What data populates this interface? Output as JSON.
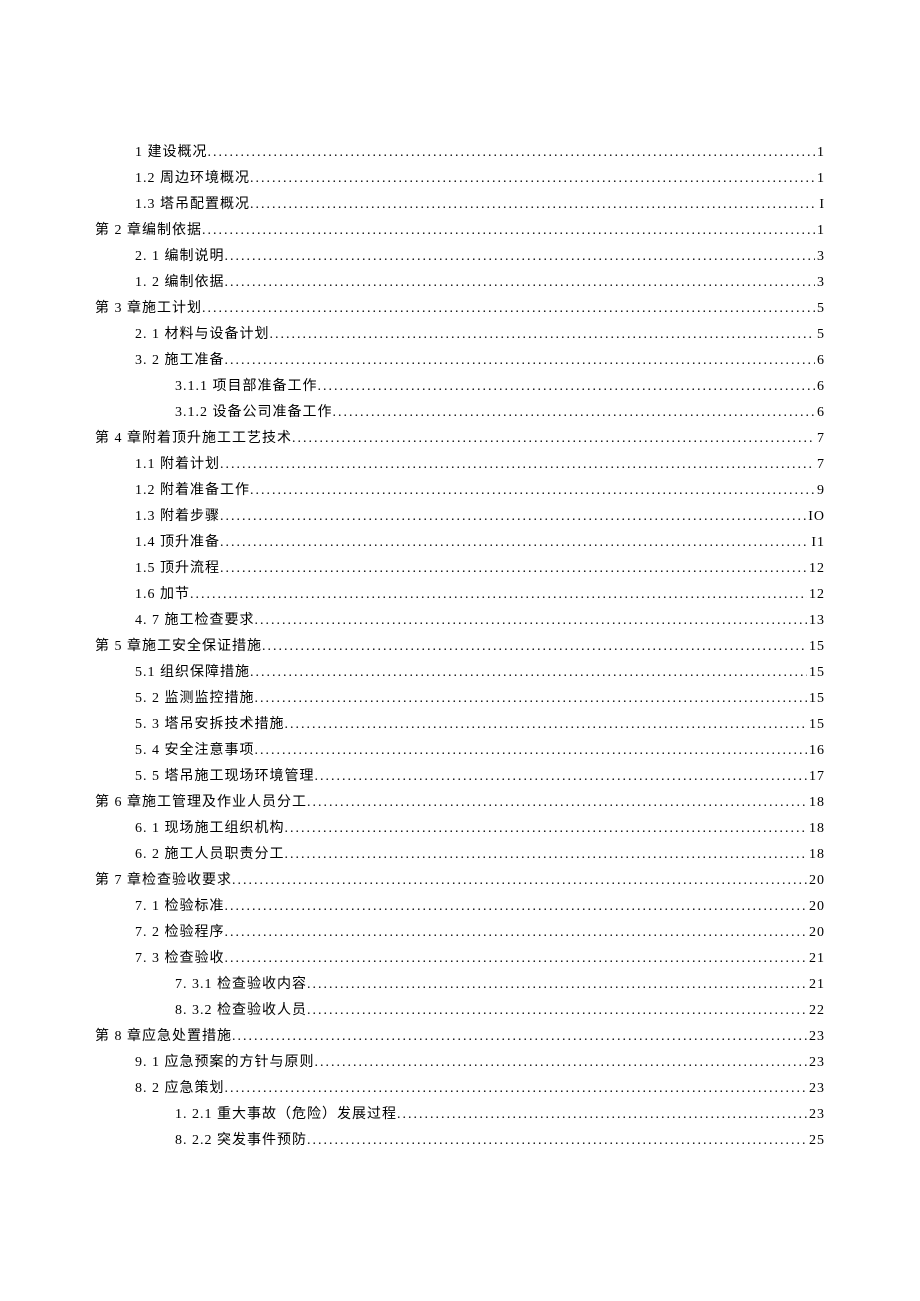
{
  "toc": [
    {
      "indent": 1,
      "label": "1 建设概况",
      "page": "1"
    },
    {
      "indent": 1,
      "label": "1.2 周边环境概况",
      "page": "1"
    },
    {
      "indent": 1,
      "label": "1.3 塔吊配置概况",
      "page": "I"
    },
    {
      "indent": 0,
      "label": "第 2 章编制依据 ",
      "page": "1"
    },
    {
      "indent": 1,
      "label": "2.  1 编制说明 ",
      "page": "3"
    },
    {
      "indent": 1,
      "label": "1.  2 编制依据 ",
      "page": "3"
    },
    {
      "indent": 0,
      "label": "第 3 章施工计划 ",
      "page": "5"
    },
    {
      "indent": 1,
      "label": "2.  1 材料与设备计划 ",
      "page": "5"
    },
    {
      "indent": 1,
      "label": "3.  2 施工准备 ",
      "page": "6"
    },
    {
      "indent": 2,
      "label": "3.1.1 项目部准备工作 ",
      "page": "6"
    },
    {
      "indent": 2,
      "label": "3.1.2 设备公司准备工作 ",
      "page": "6"
    },
    {
      "indent": 0,
      "label": "第 4 章附着顶升施工工艺技术 ",
      "page": "7"
    },
    {
      "indent": 1,
      "label": "1.1  附着计划 ",
      "page": "7"
    },
    {
      "indent": 1,
      "label": "1.2  附着准备工作",
      "page": "9"
    },
    {
      "indent": 1,
      "label": "1.3  附着步骤",
      "page": "IO"
    },
    {
      "indent": 1,
      "label": "1.4  顶升准备",
      "page": "I1"
    },
    {
      "indent": 1,
      "label": "1.5  顶升流程",
      "page": "12"
    },
    {
      "indent": 1,
      "label": "1.6  加节",
      "page": "12"
    },
    {
      "indent": 1,
      "label": "4.  7 施工检查要求 ",
      "page": "13"
    },
    {
      "indent": 0,
      "label": "第 5 章施工安全保证措施 ",
      "page": "15"
    },
    {
      "indent": 1,
      "label": "5.1 组织保障措施",
      "page": "15"
    },
    {
      "indent": 1,
      "label": "5.  2 监测监控措施 ",
      "page": "15"
    },
    {
      "indent": 1,
      "label": "5.  3 塔吊安拆技术措施 ",
      "page": "15"
    },
    {
      "indent": 1,
      "label": "5.  4 安全注意事项 ",
      "page": "16"
    },
    {
      "indent": 1,
      "label": "5.  5 塔吊施工现场环境管理 ",
      "page": "17"
    },
    {
      "indent": 0,
      "label": "第 6 章施工管理及作业人员分工 ",
      "page": "18"
    },
    {
      "indent": 1,
      "label": "6.  1 现场施工组织机构 ",
      "page": "18"
    },
    {
      "indent": 1,
      "label": "6.  2 施工人员职责分工 ",
      "page": "18"
    },
    {
      "indent": 0,
      "label": "第 7 章检查验收要求 ",
      "page": "20"
    },
    {
      "indent": 1,
      "label": "7.  1 检验标准 ",
      "page": "20"
    },
    {
      "indent": 1,
      "label": "7.  2 检验程序 ",
      "page": "20"
    },
    {
      "indent": 1,
      "label": "7.  3 检查验收 ",
      "page": "21"
    },
    {
      "indent": 2,
      "label": "7.  3.1 检查验收内容 ",
      "page": "21"
    },
    {
      "indent": 2,
      "label": "8.  3.2 检查验收人员 ",
      "page": "22"
    },
    {
      "indent": 0,
      "label": "第 8 章应急处置措施 ",
      "page": "23"
    },
    {
      "indent": 1,
      "label": "9.  1 应急预案的方针与原则 ",
      "page": "23"
    },
    {
      "indent": 1,
      "label": "8.  2 应急策划 ",
      "page": "23"
    },
    {
      "indent": 2,
      "label": "1.  2.1 重大事故（危险）发展过程 ",
      "page": "23"
    },
    {
      "indent": 2,
      "label": "8.  2.2 突发事件预防 ",
      "page": "25"
    }
  ]
}
